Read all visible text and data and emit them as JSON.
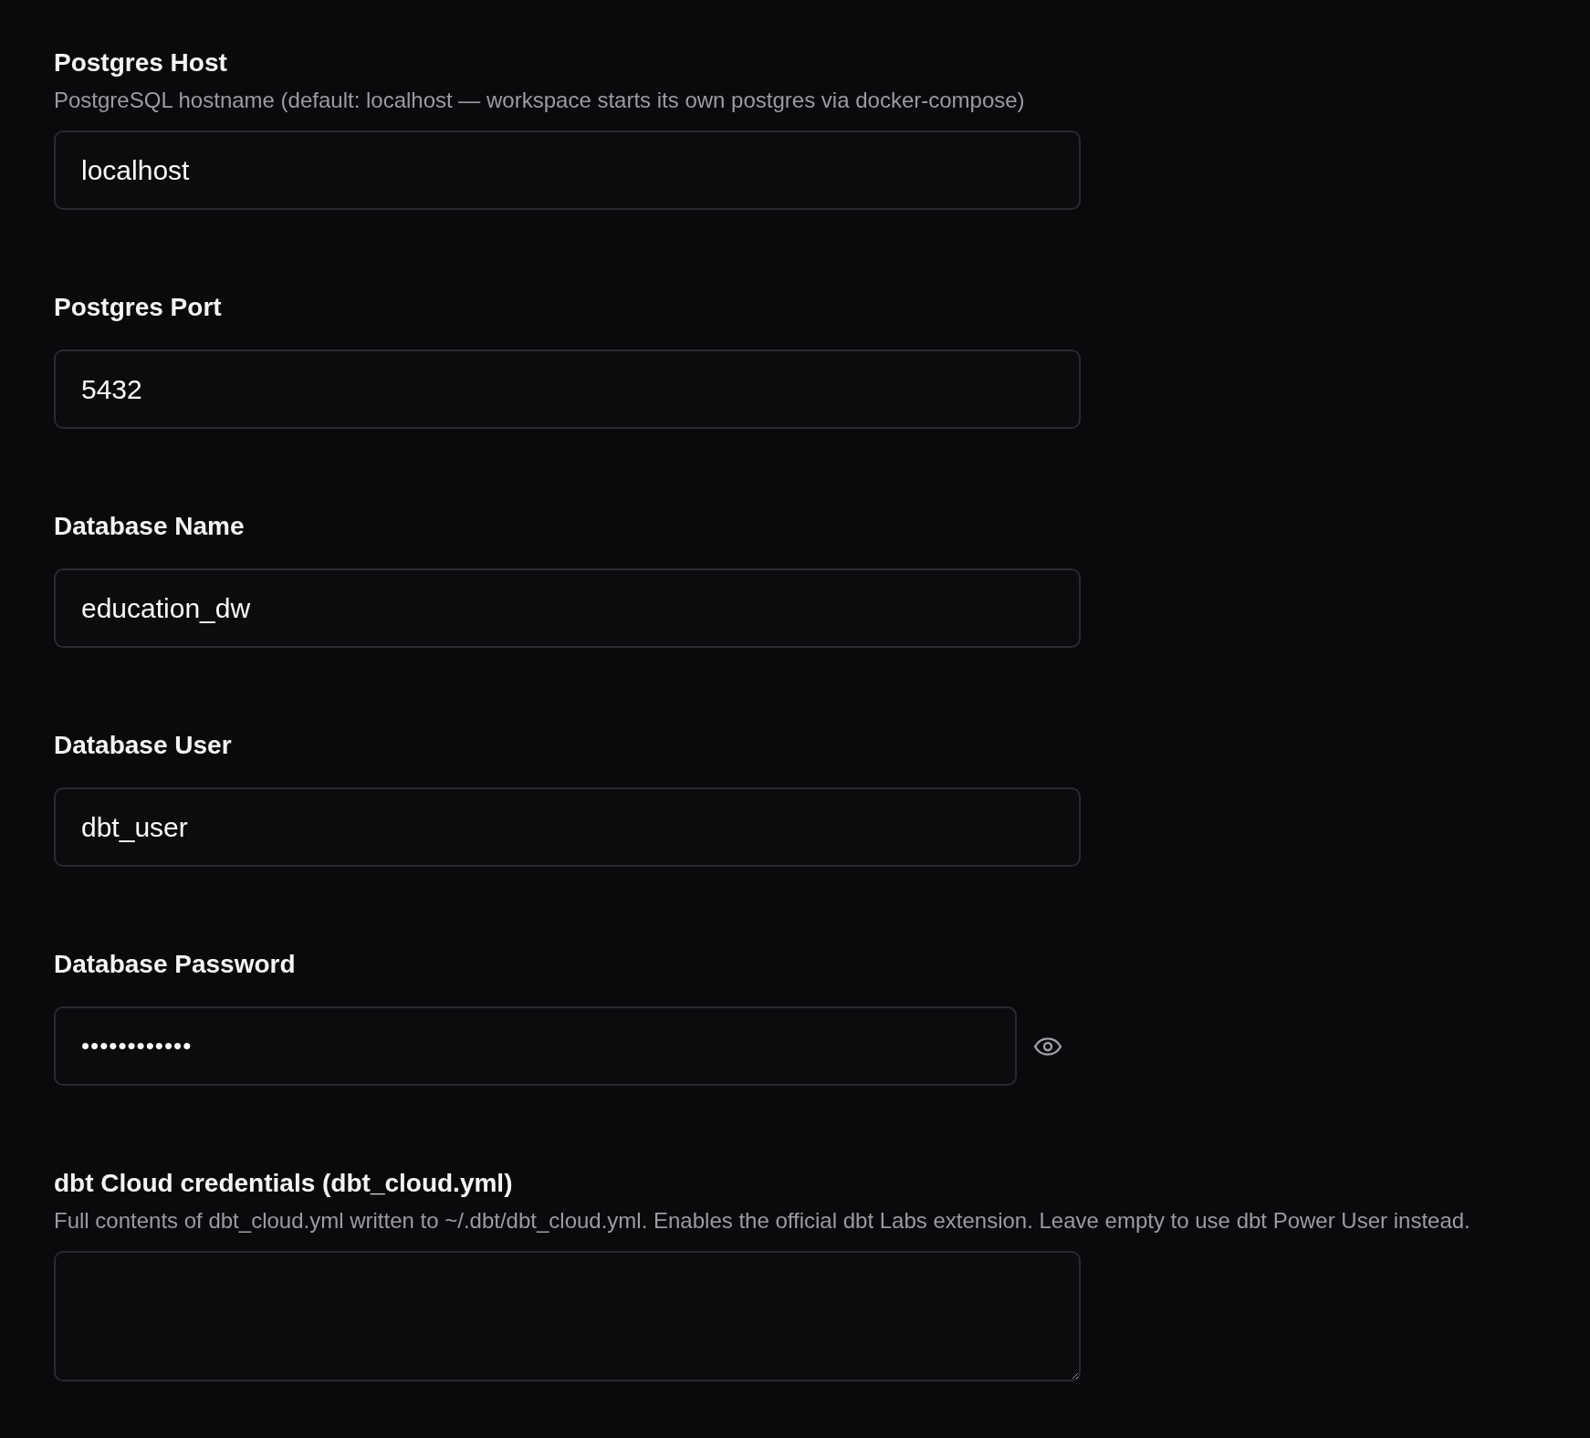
{
  "fields": [
    {
      "kind": "text",
      "label": "Postgres Host",
      "description": "PostgreSQL hostname (default: localhost — workspace starts its own postgres via docker-compose)",
      "value": "localhost"
    },
    {
      "kind": "text",
      "label": "Postgres Port",
      "value": "5432"
    },
    {
      "kind": "text",
      "label": "Database Name",
      "value": "education_dw"
    },
    {
      "kind": "text",
      "label": "Database User",
      "value": "dbt_user"
    },
    {
      "kind": "password",
      "label": "Database Password",
      "value": "••••••••••••"
    },
    {
      "kind": "textarea",
      "label": "dbt Cloud credentials (dbt_cloud.yml)",
      "description": "Full contents of dbt_cloud.yml written to ~/.dbt/dbt_cloud.yml. Enables the official dbt Labs extension. Leave empty to use dbt Power User instead."
    }
  ]
}
